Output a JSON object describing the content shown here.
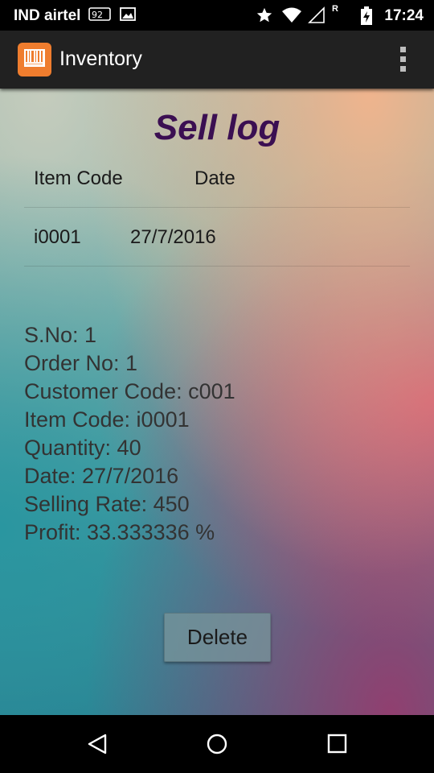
{
  "status_bar": {
    "carrier": "IND airtel",
    "time": "17:24",
    "icons": [
      "volte-icon",
      "image-icon",
      "star-icon",
      "wifi-icon",
      "signal-icon",
      "battery-charging-icon"
    ]
  },
  "app_bar": {
    "title": "Inventory",
    "logo_icon": "barcode-icon",
    "menu_icon": "overflow-menu-icon"
  },
  "page": {
    "title": "Sell log",
    "columns": [
      "Item Code",
      "Date"
    ],
    "rows": [
      {
        "item_code": "i0001",
        "date": "27/7/2016"
      }
    ],
    "details": [
      "S.No: 1",
      "Order No: 1",
      "Customer Code: c001",
      "Item Code: i0001",
      "Quantity: 40",
      "Date: 27/7/2016",
      "Selling Rate: 450",
      "Profit: 33.333336 %"
    ],
    "delete_label": "Delete"
  },
  "nav_bar": {
    "icons": [
      "back-icon",
      "home-icon",
      "recents-icon"
    ]
  },
  "colors": {
    "title": "#3b0f52",
    "app_bar": "#212121",
    "logo": "#ef7d2e"
  }
}
